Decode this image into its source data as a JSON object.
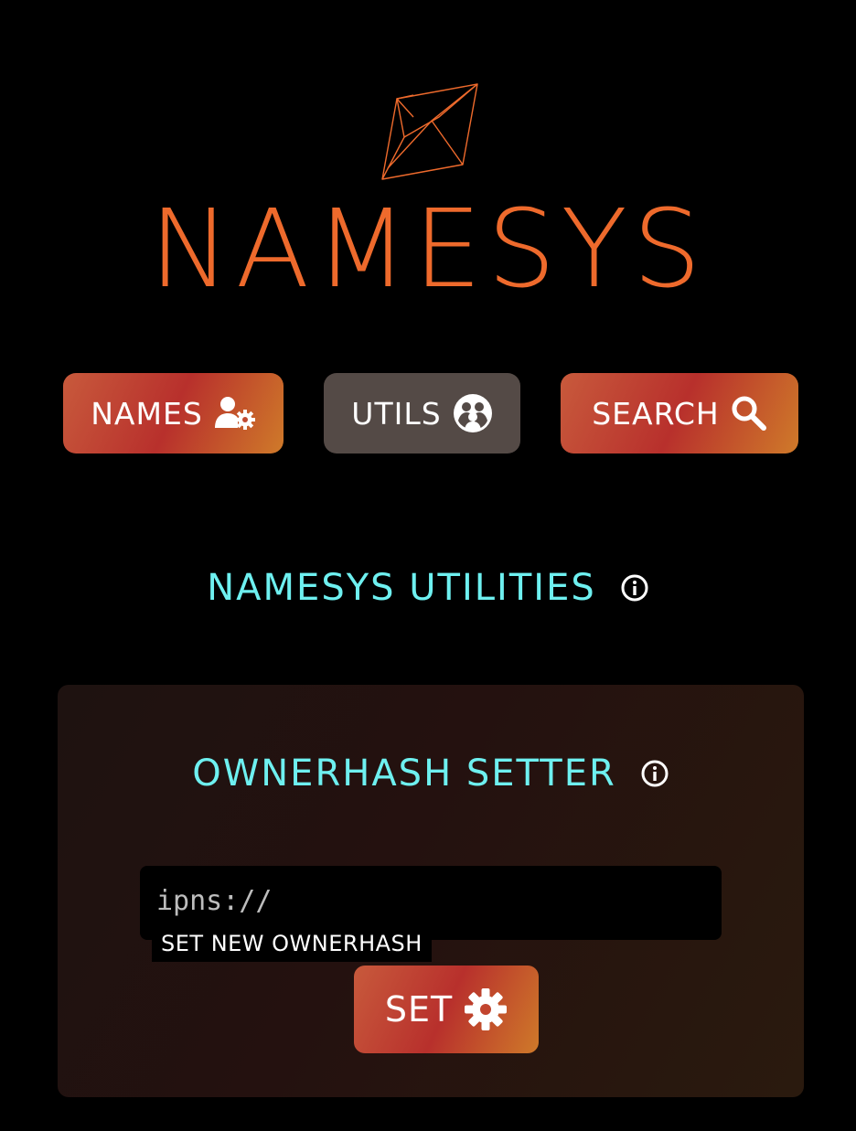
{
  "brand": {
    "logo_icon": "envelope-diamond-logo-icon",
    "name": "NAMESYS",
    "color": "#ee6a2c"
  },
  "nav": {
    "names_label": "NAMES",
    "names_icon": "user-gear-icon",
    "utils_label": "UTILS",
    "utils_icon": "users-circle-icon",
    "search_label": "SEARCH",
    "search_icon": "search-icon",
    "active": "UTILS"
  },
  "section": {
    "title": "NAMESYS UTILITIES",
    "info_icon": "info-icon"
  },
  "ownerhash": {
    "title": "OWNERHASH SETTER",
    "info_icon": "info-icon",
    "input_value": "",
    "input_placeholder": "ipns://",
    "hint": "SET NEW OWNERHASH",
    "set_label": "SET",
    "set_icon": "gear-icon"
  },
  "colors": {
    "accent": "#ee6a2c",
    "heading": "#6ef0f0",
    "button_gradient": [
      "#c85a3c",
      "#b8302c",
      "#cf7a2a"
    ],
    "active_tab": "#544a46"
  }
}
